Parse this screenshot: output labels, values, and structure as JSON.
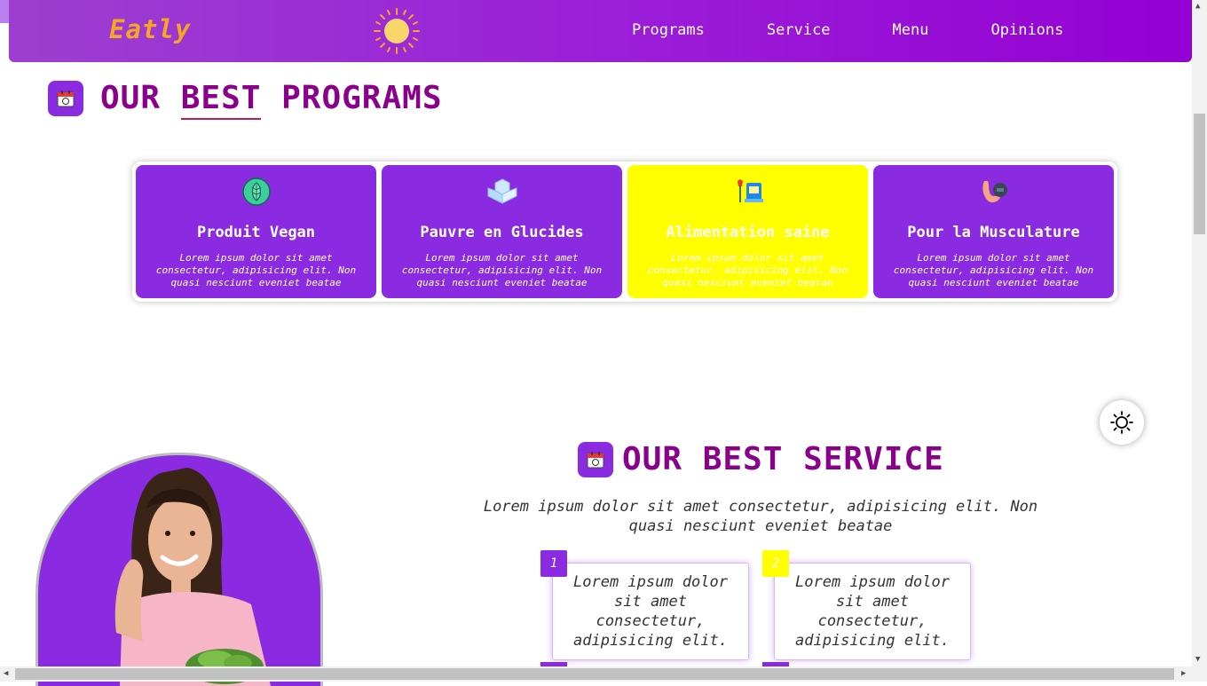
{
  "brand": {
    "logo": "Eatly",
    "accent": "#8a2be2",
    "title_color": "#8b008b",
    "logo_color": "#f5a623"
  },
  "nav": {
    "items": [
      "Programs",
      "Service",
      "Menu",
      "Opinions"
    ]
  },
  "programs": {
    "title_word1": "OUR",
    "title_word2": "BEST",
    "title_word3": "PROGRAMS",
    "cards": [
      {
        "title": "Produit Vegan",
        "icon": "cabbage-icon",
        "desc": "Lorem ipsum dolor sit amet consectetur, adipisicing elit. Non quasi nesciunt eveniet beatae",
        "highlighted": false
      },
      {
        "title": "Pauvre en Glucides",
        "icon": "sugar-cubes-icon",
        "desc": "Lorem ipsum dolor sit amet consectetur, adipisicing elit. Non quasi nesciunt eveniet beatae",
        "highlighted": false
      },
      {
        "title": "Alimentation saine",
        "icon": "healthy-food-icon",
        "desc": "Lorem ipsum dolor sit amet consectetur, adipisicing elit. Non quasi nesciunt eveniet beatae",
        "highlighted": true
      },
      {
        "title": "Pour la Musculature",
        "icon": "muscle-icon",
        "desc": "Lorem ipsum dolor sit amet consectetur, adipisicing elit. Non quasi nesciunt eveniet beatae",
        "highlighted": false
      }
    ]
  },
  "service": {
    "title": "OUR BEST SERVICE",
    "description": "Lorem ipsum dolor sit amet consectetur, adipisicing elit. Non quasi nesciunt eveniet beatae",
    "steps": [
      {
        "number": "1",
        "text": "Lorem ipsum dolor sit amet consectetur, adipisicing elit."
      },
      {
        "number": "2",
        "text": "Lorem ipsum dolor sit amet consectetur, adipisicing elit."
      }
    ]
  }
}
